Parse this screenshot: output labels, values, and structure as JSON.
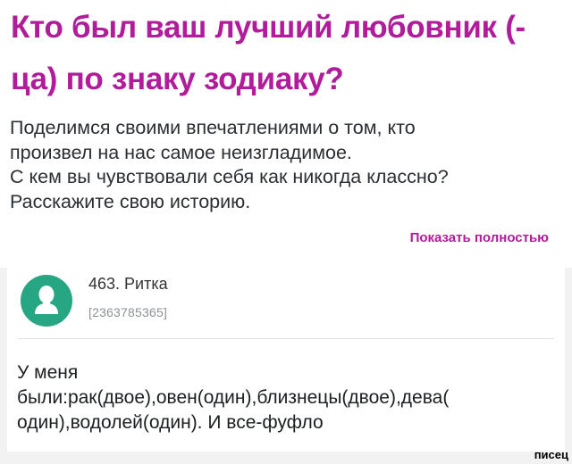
{
  "colors": {
    "accent": "#b01c9a",
    "avatar": "#27a683"
  },
  "post": {
    "title_lines": [
      "Кто был ваш лучший любовник (-",
      "ца) по знаку зодиаку?"
    ],
    "body_lines": [
      "Поделимся своими впечатлениями о том, кто",
      "произвел на нас самое неизгладимое.",
      "С кем вы чувствовали себя как никогда классно?",
      "Расскажите свою историю."
    ],
    "show_more_label": "Показать полностью"
  },
  "comment": {
    "avatar_icon": "user-silhouette-icon",
    "author": "463. Ритка",
    "user_id": "[2363785365]",
    "text_lines": [
      "У меня",
      "были:рак(двое),овен(один),близнецы(двое),дева(",
      "один),водолей(один). И все-фуфло"
    ]
  },
  "watermark": "писец"
}
